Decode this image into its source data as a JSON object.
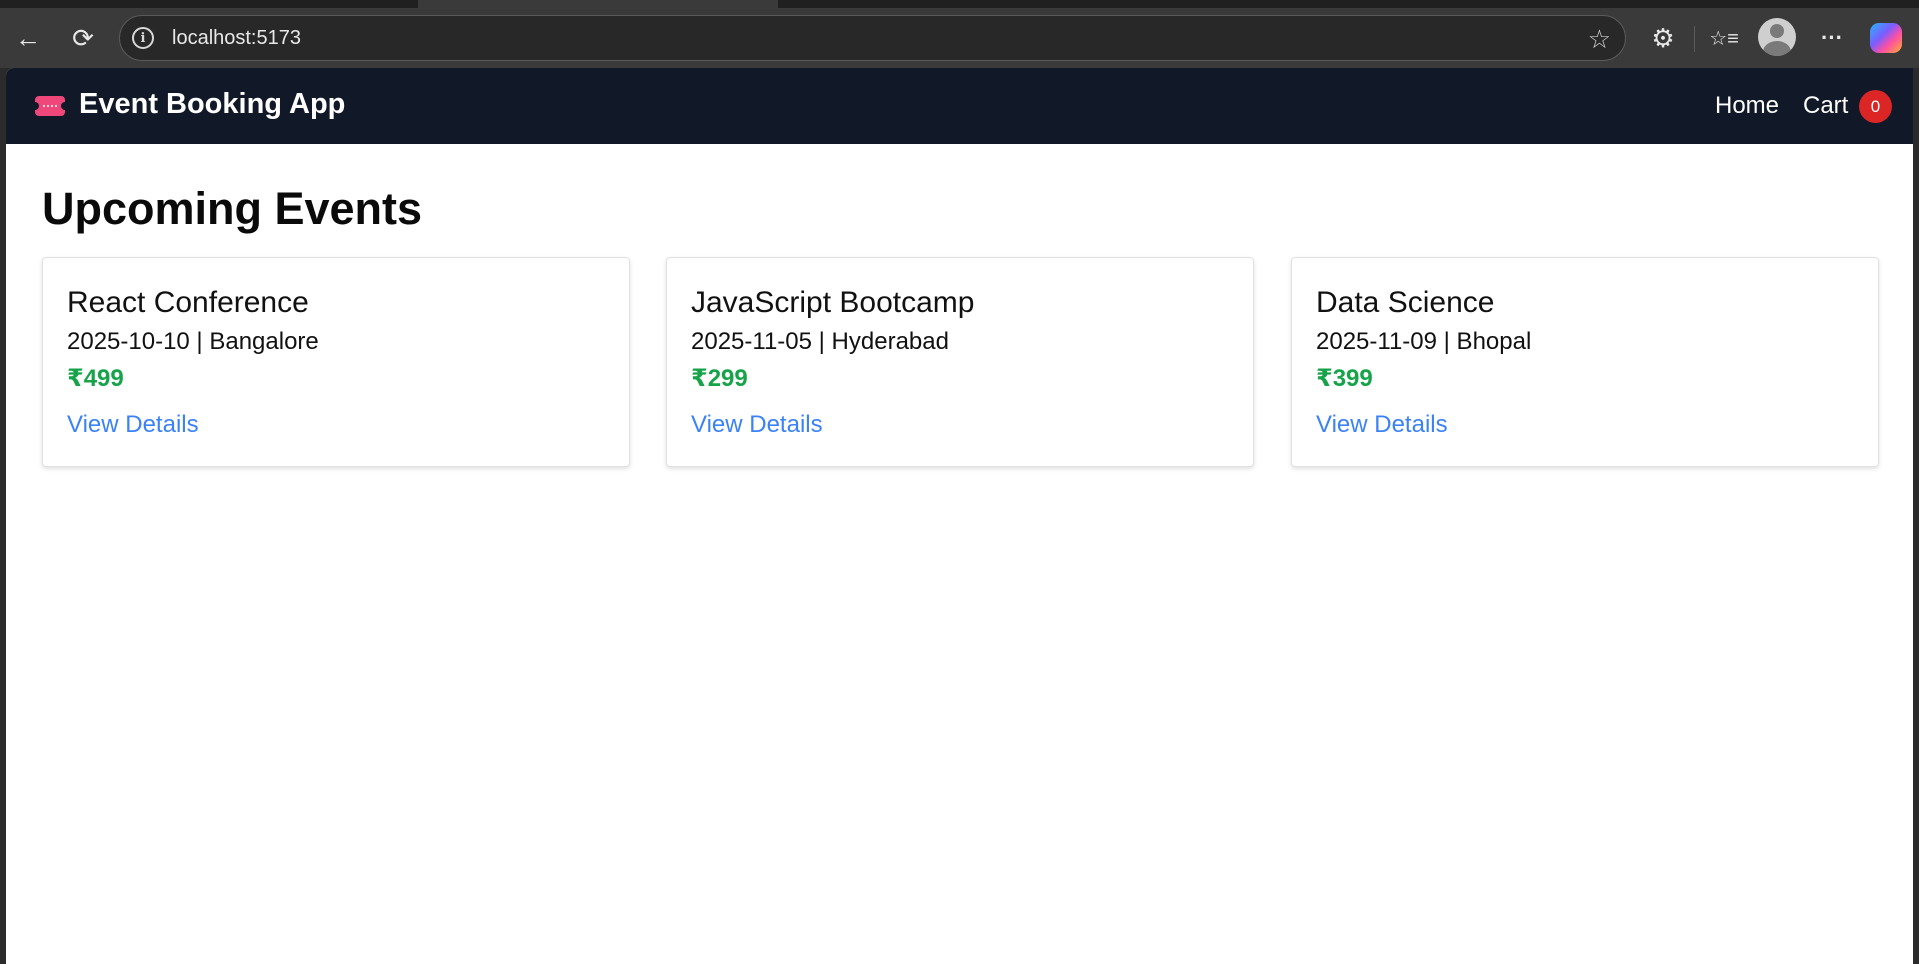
{
  "browser": {
    "url": "localhost:5173",
    "icons": {
      "back": "back-arrow-icon",
      "reload": "reload-icon",
      "site_info": "info-icon",
      "favorite": "star-icon",
      "extensions": "puzzle-icon",
      "favorites": "favorites-icon",
      "profile": "avatar-icon",
      "more": "more-icon",
      "copilot": "copilot-icon"
    },
    "glyphs": {
      "back": "←",
      "reload": "⟳",
      "info": "i",
      "star": "☆",
      "extensions": "⚙",
      "favorites": "☆≡",
      "more": "···"
    }
  },
  "app": {
    "brand": "Event Booking App",
    "brand_icon": "ticket-icon",
    "nav": {
      "home": "Home",
      "cart": "Cart",
      "cart_count": "0"
    },
    "colors": {
      "navbar": "#111827",
      "price": "#16a34a",
      "link": "#3b82f6",
      "badge": "#dc2626",
      "ticket": "#f0477a"
    }
  },
  "main": {
    "title": "Upcoming Events",
    "events": [
      {
        "name": "React Conference",
        "meta": "2025-10-10 | Bangalore",
        "price": "₹499",
        "link": "View Details"
      },
      {
        "name": "JavaScript Bootcamp",
        "meta": "2025-11-05 | Hyderabad",
        "price": "₹299",
        "link": "View Details"
      },
      {
        "name": "Data Science",
        "meta": "2025-11-09 | Bhopal",
        "price": "₹399",
        "link": "View Details"
      }
    ]
  }
}
